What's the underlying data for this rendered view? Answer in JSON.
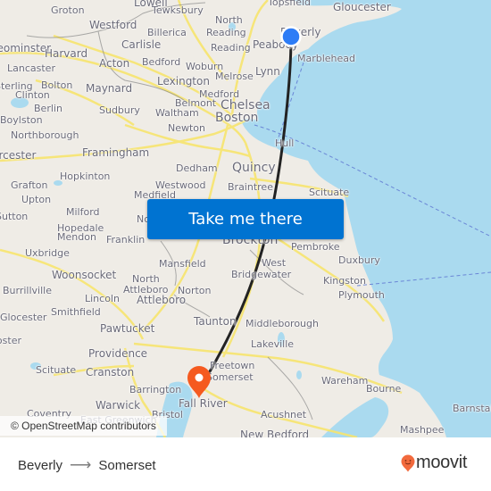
{
  "map": {
    "attribution": "© OpenStreetMap contributors",
    "colors": {
      "land": "#efece6",
      "water": "#aadaef",
      "road": "#f7e56e",
      "route": "#222222",
      "origin": "#2d7cf6",
      "destination": "#f55a1f"
    },
    "places": [
      {
        "name": "Groton",
        "size": "s"
      },
      {
        "name": "Lowell",
        "size": "m"
      },
      {
        "name": "Tewksbury",
        "size": "s"
      },
      {
        "name": "Topsfield",
        "size": "s"
      },
      {
        "name": "Gloucester",
        "size": "m"
      },
      {
        "name": "Westford",
        "size": "m"
      },
      {
        "name": "North",
        "size": "s"
      },
      {
        "name": "Reading",
        "size": "s"
      },
      {
        "name": "Beverly",
        "size": "m"
      },
      {
        "name": "Billerica",
        "size": "s"
      },
      {
        "name": "Carlisle",
        "size": "m"
      },
      {
        "name": "Leominster",
        "size": "m"
      },
      {
        "name": "Harvard",
        "size": "m"
      },
      {
        "name": "Reading",
        "size": "s"
      },
      {
        "name": "Peabody",
        "size": "m"
      },
      {
        "name": "Lancaster",
        "size": "s"
      },
      {
        "name": "Acton",
        "size": "m"
      },
      {
        "name": "Bedford",
        "size": "s"
      },
      {
        "name": "Woburn",
        "size": "s"
      },
      {
        "name": "Marblehead",
        "size": "s"
      },
      {
        "name": "Lynn",
        "size": "m"
      },
      {
        "name": "Sterling",
        "size": "s"
      },
      {
        "name": "Bolton",
        "size": "s"
      },
      {
        "name": "Maynard",
        "size": "m"
      },
      {
        "name": "Lexington",
        "size": "m"
      },
      {
        "name": "Melrose",
        "size": "s"
      },
      {
        "name": "Clinton",
        "size": "s"
      },
      {
        "name": "Medford",
        "size": "s"
      },
      {
        "name": "Berlin",
        "size": "s"
      },
      {
        "name": "Sudbury",
        "size": "s"
      },
      {
        "name": "Belmont",
        "size": "s"
      },
      {
        "name": "Chelsea",
        "size": "l"
      },
      {
        "name": "Waltham",
        "size": "s"
      },
      {
        "name": "Boylston",
        "size": "s"
      },
      {
        "name": "Boston",
        "size": "l"
      },
      {
        "name": "Northborough",
        "size": "s"
      },
      {
        "name": "Newton",
        "size": "s"
      },
      {
        "name": "Hull",
        "size": "s"
      },
      {
        "name": "Worcester",
        "size": "m"
      },
      {
        "name": "Framingham",
        "size": "m"
      },
      {
        "name": "Dedham",
        "size": "s"
      },
      {
        "name": "Quincy",
        "size": "l"
      },
      {
        "name": "Grafton",
        "size": "s"
      },
      {
        "name": "Hopkinton",
        "size": "s"
      },
      {
        "name": "Westwood",
        "size": "s"
      },
      {
        "name": "Braintree",
        "size": "s"
      },
      {
        "name": "Scituate",
        "size": "s"
      },
      {
        "name": "Upton",
        "size": "s"
      },
      {
        "name": "Medfield",
        "size": "s"
      },
      {
        "name": "Milford",
        "size": "s"
      },
      {
        "name": "Sutton",
        "size": "s"
      },
      {
        "name": "Hopedale",
        "size": "s"
      },
      {
        "name": "Norwood",
        "size": "s"
      },
      {
        "name": "Mendon",
        "size": "s"
      },
      {
        "name": "Franklin",
        "size": "s"
      },
      {
        "name": "Brockton",
        "size": "l"
      },
      {
        "name": "Pembroke",
        "size": "s"
      },
      {
        "name": "Uxbridge",
        "size": "s"
      },
      {
        "name": "Mansfield",
        "size": "s"
      },
      {
        "name": "West",
        "size": "s"
      },
      {
        "name": "Duxbury",
        "size": "s"
      },
      {
        "name": "Bridgewater",
        "size": "s"
      },
      {
        "name": "Woonsocket",
        "size": "m"
      },
      {
        "name": "North",
        "size": "s"
      },
      {
        "name": "Kingston",
        "size": "s"
      },
      {
        "name": "Burrillville",
        "size": "s"
      },
      {
        "name": "Attleboro",
        "size": "s"
      },
      {
        "name": "Norton",
        "size": "s"
      },
      {
        "name": "Lincoln",
        "size": "s"
      },
      {
        "name": "Plymouth",
        "size": "s"
      },
      {
        "name": "Attleboro",
        "size": "m"
      },
      {
        "name": "Glocester",
        "size": "s"
      },
      {
        "name": "Smithfield",
        "size": "s"
      },
      {
        "name": "Taunton",
        "size": "m"
      },
      {
        "name": "Middleborough",
        "size": "s"
      },
      {
        "name": "Foster",
        "size": "s"
      },
      {
        "name": "Pawtucket",
        "size": "m"
      },
      {
        "name": "Lakeville",
        "size": "s"
      },
      {
        "name": "Providence",
        "size": "m"
      },
      {
        "name": "Freetown",
        "size": "s"
      },
      {
        "name": "Scituate",
        "size": "s"
      },
      {
        "name": "Cranston",
        "size": "m"
      },
      {
        "name": "Somerset",
        "size": "s"
      },
      {
        "name": "Wareham",
        "size": "s"
      },
      {
        "name": "Bourne",
        "size": "s"
      },
      {
        "name": "Barrington",
        "size": "s"
      },
      {
        "name": "Coventry",
        "size": "s"
      },
      {
        "name": "Warwick",
        "size": "m"
      },
      {
        "name": "Fall River",
        "size": "m"
      },
      {
        "name": "Bristol",
        "size": "s"
      },
      {
        "name": "Barnstable",
        "size": "s"
      },
      {
        "name": "Acushnet",
        "size": "s"
      },
      {
        "name": "East Greenwich",
        "size": "s"
      },
      {
        "name": "Mashpee",
        "size": "s"
      },
      {
        "name": "New Bedford",
        "size": "m"
      }
    ]
  },
  "cta": {
    "label": "Take me there"
  },
  "footer": {
    "origin": "Beverly",
    "arrow_icon": "arrow-right-icon",
    "destination": "Somerset",
    "brand": "moovit"
  }
}
